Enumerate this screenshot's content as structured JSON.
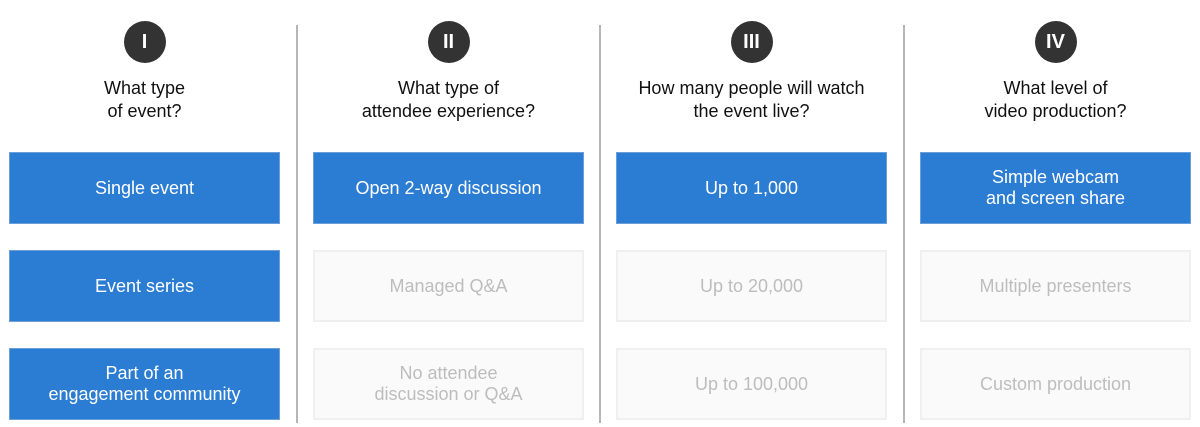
{
  "colors": {
    "selected": "#2b7cd3",
    "unselected_text": "#bdbdbd",
    "badge": "#333333"
  },
  "columns": [
    {
      "numeral": "I",
      "question": "What type\nof event?",
      "options": [
        {
          "label": "Single event",
          "selected": true
        },
        {
          "label": "Event series",
          "selected": true
        },
        {
          "label": "Part of an\nengagement community",
          "selected": true
        }
      ]
    },
    {
      "numeral": "II",
      "question": "What type of\nattendee experience?",
      "options": [
        {
          "label": "Open 2-way discussion",
          "selected": true
        },
        {
          "label": "Managed Q&A",
          "selected": false
        },
        {
          "label": "No attendee\ndiscussion or Q&A",
          "selected": false
        }
      ]
    },
    {
      "numeral": "III",
      "question": "How many people will watch\nthe event live?",
      "options": [
        {
          "label": "Up to 1,000",
          "selected": true
        },
        {
          "label": "Up to 20,000",
          "selected": false
        },
        {
          "label": "Up to 100,000",
          "selected": false
        }
      ]
    },
    {
      "numeral": "IV",
      "question": "What level of\nvideo production?",
      "options": [
        {
          "label": "Simple webcam\nand screen share",
          "selected": true
        },
        {
          "label": "Multiple presenters",
          "selected": false
        },
        {
          "label": "Custom production",
          "selected": false
        }
      ]
    }
  ]
}
